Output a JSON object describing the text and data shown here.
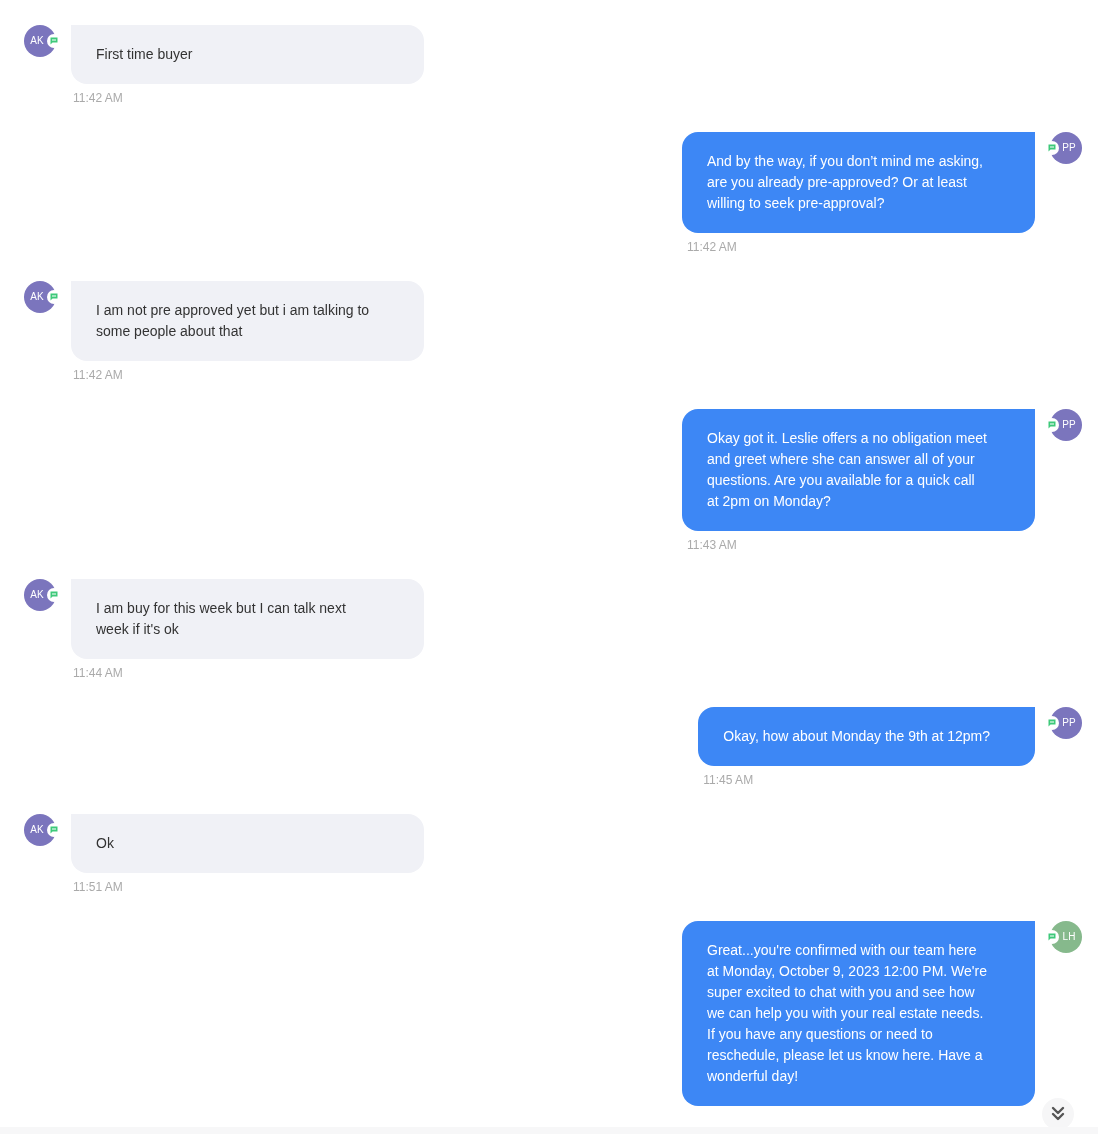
{
  "messages": [
    {
      "kind": "incoming",
      "initials": "AK",
      "color": "#7b75bd",
      "text": "First time buyer",
      "time": "11:42 AM"
    },
    {
      "kind": "outgoing",
      "initials": "PP",
      "color": "#7b75bd",
      "text": "And by the way, if you don’t mind me asking, are you already pre-approved? Or at least willing to seek pre-approval?",
      "time": "11:42 AM"
    },
    {
      "kind": "incoming",
      "initials": "AK",
      "color": "#7b75bd",
      "text": "I am not pre approved yet but i am talking to some people about that",
      "time": "11:42 AM"
    },
    {
      "kind": "outgoing",
      "initials": "PP",
      "color": "#7b75bd",
      "text": "Okay got it. Leslie offers a no obligation meet and greet where she can answer all of your questions. Are you available for a quick call at 2pm on Monday?",
      "time": "11:43 AM"
    },
    {
      "kind": "incoming",
      "initials": "AK",
      "color": "#7b75bd",
      "text": "I am buy for this week but I can talk next week if it's ok",
      "time": "11:44 AM"
    },
    {
      "kind": "outgoing",
      "initials": "PP",
      "color": "#7b75bd",
      "text": "Okay, how about Monday the 9th at 12pm?",
      "time": "11:45 AM"
    },
    {
      "kind": "incoming",
      "initials": "AK",
      "color": "#7b75bd",
      "text": "Ok",
      "time": "11:51 AM"
    },
    {
      "kind": "outgoing",
      "initials": "LH",
      "color": "#86b98c",
      "text": "Great...you're confirmed with our team here at Monday, October 9, 2023 12:00 PM. We're super excited to chat with you and see how we can help you with your real estate needs. If you have any questions or need to reschedule, please let us know here. Have a wonderful day!"
    }
  ]
}
